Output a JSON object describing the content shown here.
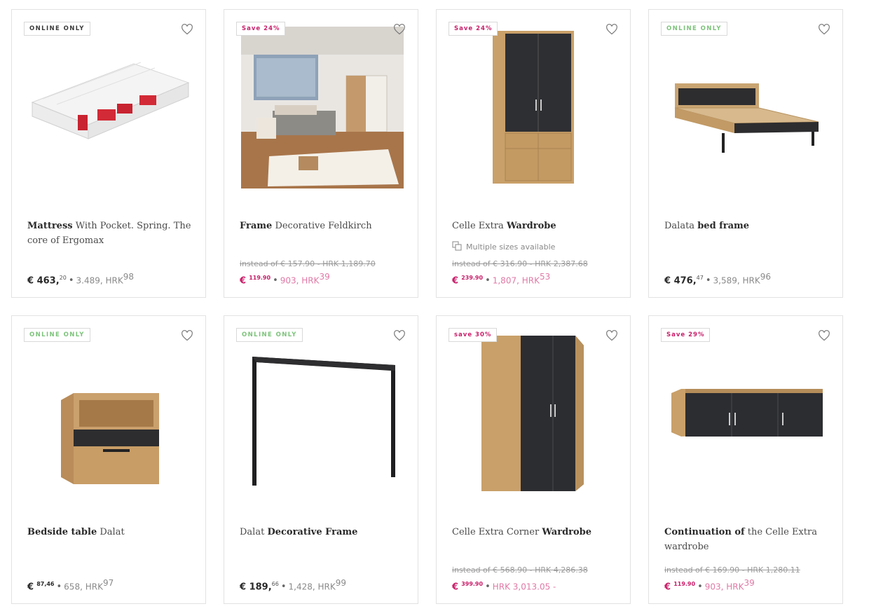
{
  "products": [
    {
      "badge": "ONLINE ONLY",
      "badge_type": "online",
      "title_bold": "Mattress",
      "title_rest": " With Pocket. Spring. The core of Ergomax",
      "title_order": "bold-first",
      "sizes": "",
      "old_price": "",
      "price_main": "€ 463,",
      "price_sup": "20",
      "price_conv": "3.489, HRK",
      "price_conv_sup": "98",
      "sale": false,
      "image": "mattress"
    },
    {
      "badge": "Save 24%",
      "badge_type": "save",
      "title_bold": "Frame",
      "title_rest": " Decorative Feldkirch",
      "title_order": "bold-first",
      "sizes": "",
      "old_price": "instead of € 157.90 - HRK 1,189.70",
      "price_main": "€",
      "price_sup": "119.90",
      "price_conv": "903, HRK",
      "price_conv_sup": "39",
      "sale": true,
      "image": "bedroom-photo"
    },
    {
      "badge": "Save 24%",
      "badge_type": "save",
      "title_bold": "Wardrobe",
      "title_rest": "Celle Extra ",
      "title_order": "rest-first",
      "sizes": "Multiple sizes available",
      "old_price": "instead of € 316.90 - HRK 2,387.68",
      "price_main": "€",
      "price_sup": "239.90",
      "price_conv": "1,807, HRK",
      "price_conv_sup": "53",
      "sale": true,
      "image": "wardrobe"
    },
    {
      "badge": "ONLINE ONLY",
      "badge_type": "online",
      "title_bold": "bed frame",
      "title_rest": "Dalata ",
      "title_order": "rest-first",
      "sizes": "",
      "old_price": "",
      "price_main": "€ 476,",
      "price_sup": "47",
      "price_conv": "3,589, HRK",
      "price_conv_sup": "96",
      "sale": false,
      "image": "bed-frame"
    },
    {
      "badge": "ONLINE ONLY",
      "badge_type": "online",
      "title_bold": "Bedside table",
      "title_rest": " Dalat",
      "title_order": "bold-first",
      "sizes": "",
      "old_price": "",
      "price_main": "€",
      "price_sup": "87,46",
      "price_conv": "658, HRK",
      "price_conv_sup": "97",
      "sale": false,
      "image": "bedside-table"
    },
    {
      "badge": "ONLINE ONLY",
      "badge_type": "online",
      "title_bold": "Decorative Frame",
      "title_rest": "Dalat ",
      "title_order": "rest-first",
      "sizes": "",
      "old_price": "",
      "price_main": "€ 189,",
      "price_sup": "66",
      "price_conv": "1,428, HRK",
      "price_conv_sup": "99",
      "sale": false,
      "image": "decorative-frame"
    },
    {
      "badge": "save 30%",
      "badge_type": "save",
      "title_bold": "Wardrobe",
      "title_rest": "Celle Extra Corner ",
      "title_order": "rest-first",
      "sizes": "",
      "old_price": "instead of € 568.90 - HRK 4,286.38",
      "price_main": "€",
      "price_sup": "399.90",
      "price_conv": "HRK 3,013.05 -",
      "price_conv_sup": "",
      "sale": true,
      "image": "corner-wardrobe"
    },
    {
      "badge": "Save 29%",
      "badge_type": "save",
      "title_bold": "Continuation of",
      "title_rest": " the Celle Extra wardrobe",
      "title_order": "bold-first",
      "sizes": "",
      "old_price": "instead of € 169.90 - HRK 1,280.11",
      "price_main": "€",
      "price_sup": "119.90",
      "price_conv": "903, HRK",
      "price_conv_sup": "39",
      "sale": true,
      "image": "wall-cabinet"
    }
  ]
}
